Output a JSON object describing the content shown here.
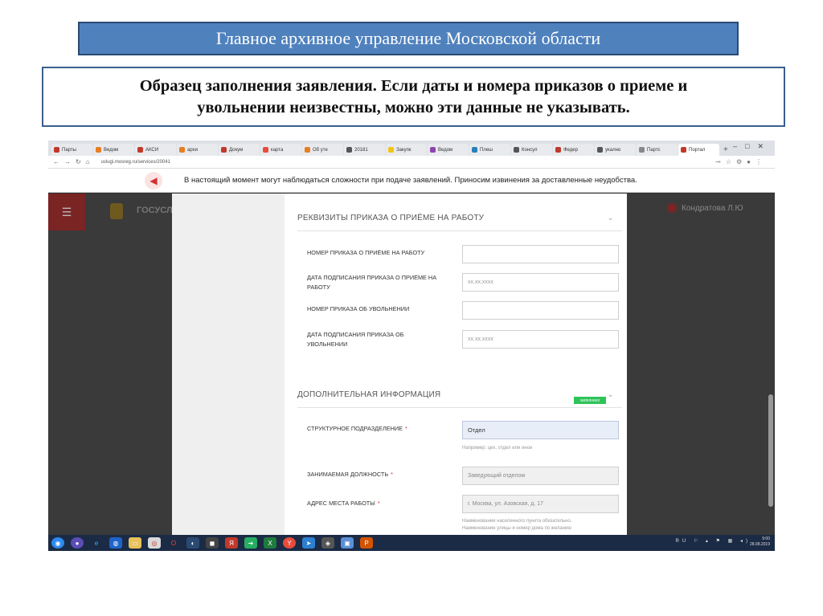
{
  "slide": {
    "title": "Главное архивное управление Московской области",
    "subtitle_line1": "Образец заполнения заявления. Если даты и номера приказов о приеме и",
    "subtitle_line2": "увольнении неизвестны, можно эти данные не указывать."
  },
  "browser": {
    "tabs": [
      "Парты",
      "Ведом",
      "АКСИ",
      "архи",
      "Докум",
      "карта",
      "Об уте",
      "20181",
      "Закупк",
      "Ведом",
      "Плеш",
      "Консул",
      "Федер",
      "укално",
      "Партс",
      "Портал"
    ],
    "url": "uslugi.mosreg.ru/services/20041"
  },
  "notice": {
    "text": "В настоящий момент могут наблюдаться сложности при подаче заявлений. Приносим извинения за доставленные неудобства."
  },
  "app": {
    "brand": "ГОСУСЛ",
    "user_name": "Кондратова Л.Ю"
  },
  "form": {
    "section1_title": "РЕКВИЗИТЫ ПРИКАЗА О ПРИЁМЕ НА РАБОТУ",
    "f1_label": "НОМЕР ПРИКАЗА О ПРИЁМЕ НА РАБОТУ",
    "f1_value": "",
    "f2_label": "ДАТА ПОДПИСАНИЯ ПРИКАЗА О ПРИЁМЕ НА РАБОТУ",
    "f2_placeholder": "xx.xx.xxxx",
    "f3_label": "НОМЕР ПРИКАЗА ОБ УВОЛЬНЕНИИ",
    "f3_value": "",
    "f4_label": "ДАТА ПОДПИСАНИЯ ПРИКАЗА ОБ УВОЛЬНЕНИИ",
    "f4_placeholder": "xx.xx.xxxx",
    "section2_title": "ДОПОЛНИТЕЛЬНАЯ ИНФОРМАЦИЯ",
    "section2_badge": "заполнено",
    "f5_label": "СТРУКТУРНОЕ ПОДРАЗДЕЛЕНИЕ",
    "f5_value": "Отдел",
    "f5_hint": "Например: цех, отдел или иное",
    "f6_label": "ЗАНИМАЕМАЯ ДОЛЖНОСТЬ",
    "f6_value": "Заведующий отделом",
    "f7_label": "АДРЕС МЕСТА РАБОТЫ",
    "f7_value": "г. Москва, ул. Азовская, д. 17",
    "f7_hint1": "Наименование населенного пункта обязательно.",
    "f7_hint2": "Наименование улицы и номер дома по желанию",
    "required_mark": "*"
  },
  "taskbar": {
    "tray": "RU",
    "time": "9:00",
    "date": "28.08.2019"
  },
  "colors": {
    "title_bar": "#4f81bd",
    "accent_red": "#7a2424",
    "badge_green": "#2ec45a"
  }
}
